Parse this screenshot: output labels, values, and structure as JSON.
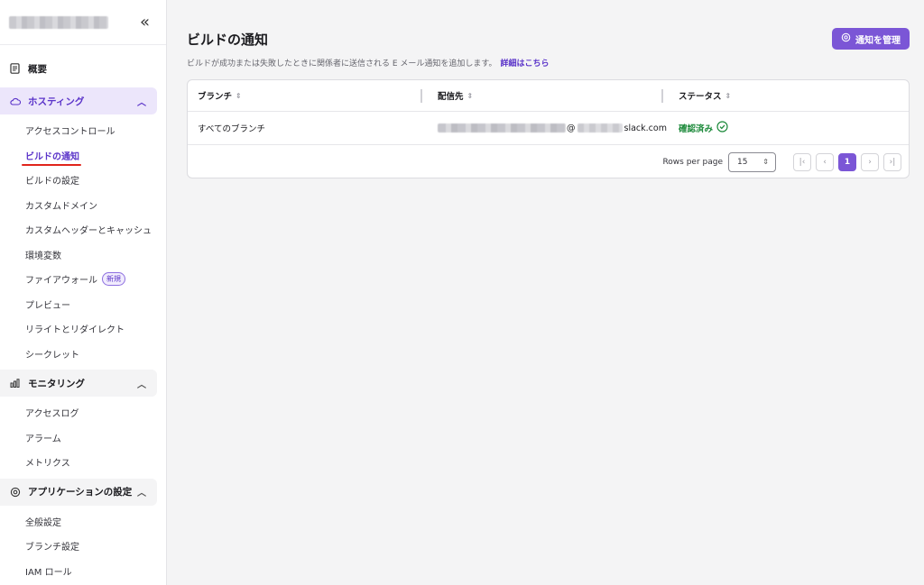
{
  "sidebar": {
    "collapse_icon": "«",
    "overview": {
      "label": "概要",
      "icon": "document-icon"
    },
    "hosting": {
      "label": "ホスティング",
      "icon": "cloud-icon",
      "items": [
        {
          "label": "アクセスコントロール"
        },
        {
          "label": "ビルドの通知"
        },
        {
          "label": "ビルドの設定"
        },
        {
          "label": "カスタムドメイン"
        },
        {
          "label": "カスタムヘッダーとキャッシュ"
        },
        {
          "label": "環境変数"
        },
        {
          "label": "ファイアウォール",
          "badge": "新規"
        },
        {
          "label": "プレビュー"
        },
        {
          "label": "リライトとリダイレクト"
        },
        {
          "label": "シークレット"
        }
      ]
    },
    "monitoring": {
      "label": "モニタリング",
      "icon": "bar-chart-icon",
      "items": [
        {
          "label": "アクセスログ"
        },
        {
          "label": "アラーム"
        },
        {
          "label": "メトリクス"
        }
      ]
    },
    "app_settings": {
      "label": "アプリケーションの設定",
      "icon": "gear-icon",
      "items": [
        {
          "label": "全般設定"
        },
        {
          "label": "ブランチ設定"
        },
        {
          "label": "IAM ロール"
        }
      ]
    }
  },
  "main": {
    "title": "ビルドの通知",
    "manage_button": "通知を管理",
    "description": "ビルドが成功または失敗したときに関係者に送信される E メール通知を追加します。",
    "details_link": "詳細はこちら",
    "table": {
      "headers": [
        "ブランチ",
        "配信先",
        "ステータス"
      ],
      "rows": [
        {
          "branch": "すべてのブランチ",
          "email_at": "@",
          "email_domain": "slack.com",
          "status": "確認済み"
        }
      ]
    },
    "pagination": {
      "rows_per_page_label": "Rows per page",
      "rows_per_page": "15",
      "current_page": "1"
    }
  },
  "colors": {
    "accent": "#7b56d6",
    "status_ok": "#1d8a3b",
    "highlight_underline": "#e0241b"
  }
}
